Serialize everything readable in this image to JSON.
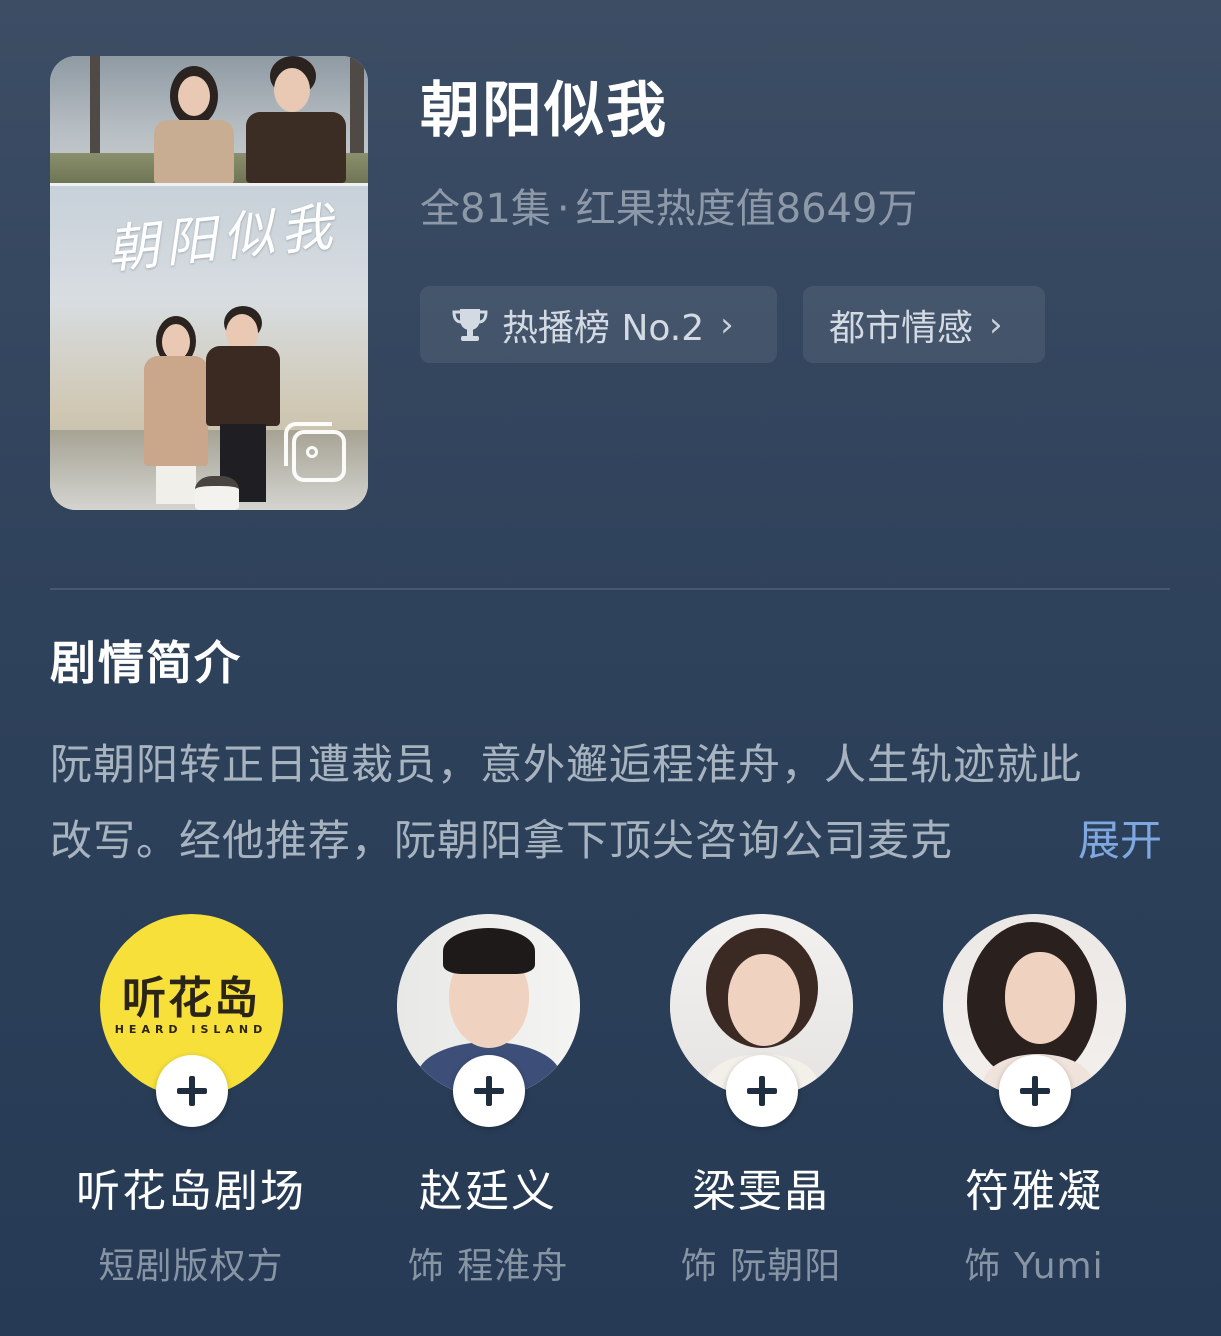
{
  "drama": {
    "title": "朝阳似我",
    "episodes": "全81集",
    "separator": "·",
    "heat": "红果热度值8649万",
    "poster_title": "朝阳似我",
    "rank_tag": "热播榜 No.2",
    "genre_tag": "都市情感",
    "chevron": "›"
  },
  "synopsis": {
    "heading": "剧情简介",
    "line1": "阮朝阳转正日遭裁员，意外邂逅程淮舟，人生轨迹就此",
    "line2": "改写。经他推荐，阮朝阳拿下顶尖咨询公司麦克",
    "expand": "展开"
  },
  "cast": [
    {
      "name": "听花岛剧场",
      "role": "短剧版权方",
      "logo_text": "听花岛",
      "logo_sub": "HEARD ISLAND"
    },
    {
      "name": "赵廷义",
      "role": "饰 程淮舟"
    },
    {
      "name": "梁雯晶",
      "role": "饰 阮朝阳"
    },
    {
      "name": "符雅凝",
      "role": "饰 Yumi"
    }
  ],
  "icons": {
    "trophy": "trophy-icon",
    "poster_gallery": "gallery-icon",
    "follow": "plus-icon",
    "chevron": "chevron-right-icon"
  },
  "colors": {
    "background": "#2f425b",
    "meta_text": "#8d99a8",
    "expand_link": "#7fa8e0",
    "brand_yellow": "#f7e03a"
  }
}
